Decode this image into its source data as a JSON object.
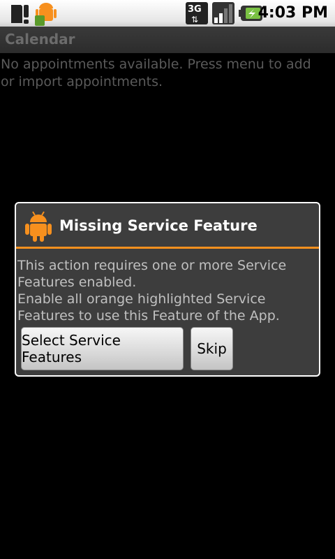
{
  "status_bar": {
    "time": "4:03 PM",
    "icons": [
      "sd-card-warning-icon",
      "android-notification-icon",
      "3g-data-icon",
      "signal-icon",
      "battery-charging-icon"
    ]
  },
  "app": {
    "title": "Calendar",
    "empty_message": "No appointments available. Press menu to add or import appointments."
  },
  "dialog": {
    "title": "Missing Service Feature",
    "icon": "android-icon",
    "message_line1": "This action requires one or more Service Features enabled.",
    "message_line2": "Enable all orange highlighted Service Features to use this Feature of the App.",
    "buttons": {
      "select": "Select Service Features",
      "skip": "Skip"
    },
    "accent": "#f7901e"
  }
}
